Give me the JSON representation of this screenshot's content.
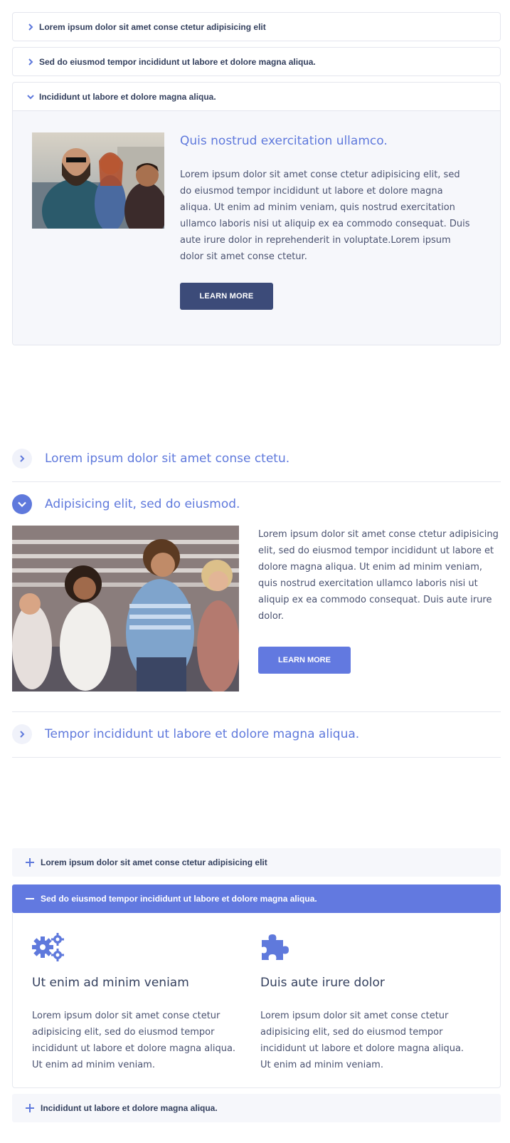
{
  "accordion1": {
    "items": [
      {
        "title": "Lorem ipsum dolor sit amet conse ctetur adipisicing elit"
      },
      {
        "title": "Sed do eiusmod tempor incididunt ut labore et dolore magna aliqua."
      },
      {
        "title": "Incididunt ut labore et dolore magna aliqua."
      }
    ],
    "open_panel": {
      "heading": "Quis nostrud exercitation ullamco.",
      "text": "Lorem ipsum dolor sit amet conse ctetur adipisicing elit, sed do eiusmod tempor incididunt ut labore et dolore magna aliqua. Ut enim ad minim veniam, quis nostrud exercitation ullamco laboris nisi ut aliquip ex ea commodo consequat. Duis aute irure dolor in reprehenderit in voluptate.Lorem ipsum dolor sit amet conse ctetur.",
      "button": "LEARN MORE"
    }
  },
  "accordion2": {
    "items": [
      {
        "title": "Lorem ipsum dolor sit amet conse ctetu."
      },
      {
        "title": "Adipisicing elit, sed do eiusmod."
      },
      {
        "title": "Tempor incididunt ut labore et dolore magna aliqua."
      }
    ],
    "open_panel": {
      "text": "Lorem ipsum dolor sit amet conse ctetur adipisicing elit, sed do eiusmod tempor incididunt ut labore et dolore magna aliqua. Ut enim ad minim veniam, quis nostrud exercitation ullamco laboris nisi ut aliquip ex ea commodo consequat. Duis aute irure dolor.",
      "button": "LEARN MORE"
    }
  },
  "accordion3": {
    "items": [
      {
        "title": "Lorem ipsum dolor sit amet conse ctetur adipisicing elit"
      },
      {
        "title": "Sed do eiusmod tempor incididunt ut labore et dolore magna aliqua."
      },
      {
        "title": "Incididunt ut labore et dolore magna aliqua."
      }
    ],
    "open_panel": {
      "columns": [
        {
          "icon": "gears-icon",
          "heading": "Ut enim ad minim veniam",
          "text": "Lorem ipsum dolor sit amet conse ctetur adipisicing elit, sed do eiusmod tempor incididunt ut labore et dolore magna aliqua. Ut enim ad minim veniam."
        },
        {
          "icon": "puzzle-icon",
          "heading": "Duis aute irure dolor",
          "text": "Lorem ipsum dolor sit amet conse ctetur adipisicing elit, sed do eiusmod tempor incididunt ut labore et dolore magna aliqua. Ut enim ad minim veniam."
        }
      ]
    }
  },
  "colors": {
    "accent": "#5f79dc",
    "button_dark": "#3c4b79",
    "button_accent": "#6279e0",
    "text_dark": "#34405e",
    "panel_bg": "#f6f7fb"
  }
}
